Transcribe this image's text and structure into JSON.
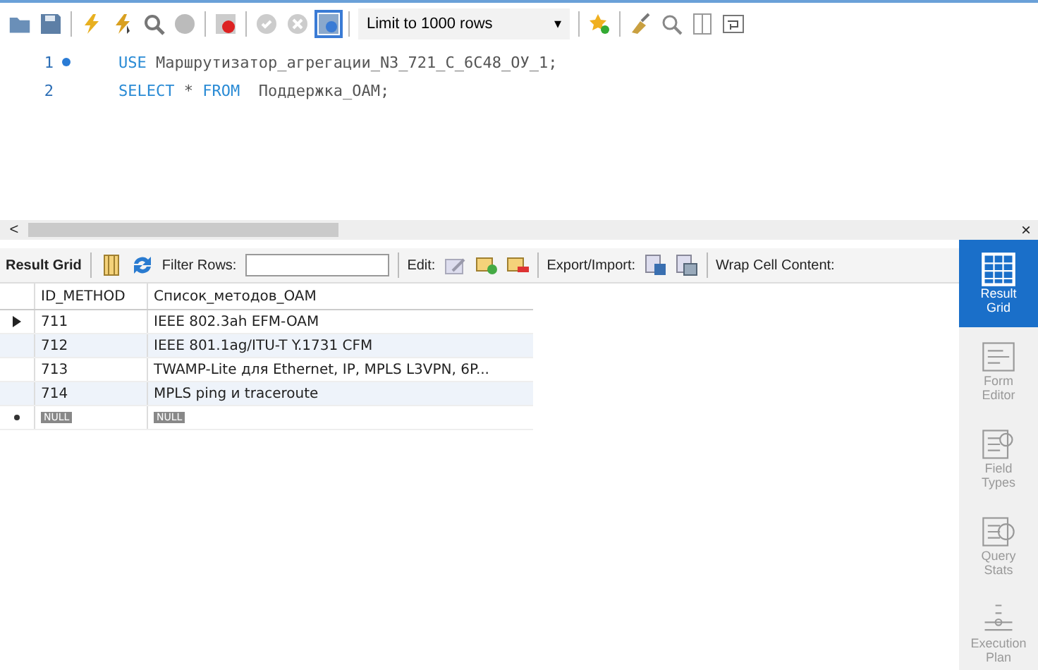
{
  "toolbar": {
    "limit": "Limit to 1000 rows",
    "caret": "▾"
  },
  "editor": {
    "lines": [
      {
        "number": "1",
        "marker": true,
        "keyword": "USE",
        "rest": "Маршрутизатор_агрегации_N3_721_C_6C48_ОУ_1;"
      },
      {
        "number": "2",
        "marker": false,
        "keyword": "SELECT",
        "rest": "* ",
        "keyword2": "FROM",
        "rest2": "Поддержка_OAM;"
      }
    ]
  },
  "scroll_left": "<",
  "close": "×",
  "result_toolbar": {
    "result_grid": "Result Grid",
    "filter_label": "Filter Rows:",
    "edit_label": "Edit:",
    "export_label": "Export/Import:",
    "wrap_label": "Wrap Cell Content:"
  },
  "table": {
    "columns": [
      "ID_METHOD",
      "Список_методов_OAM"
    ],
    "rows": [
      {
        "selected": true,
        "cells": [
          "711",
          "IEEE 802.3ah EFM-OAM"
        ]
      },
      {
        "selected": false,
        "cells": [
          "712",
          "IEEE 801.1ag/ITU-T Y.1731 CFM"
        ]
      },
      {
        "selected": false,
        "cells": [
          "713",
          "TWAMP-Lite для Ethernet, IP, MPLS L3VPN, 6P..."
        ]
      },
      {
        "selected": false,
        "cells": [
          "714",
          "MPLS ping и traceroute"
        ]
      }
    ],
    "new_row": [
      "NULL",
      "NULL"
    ]
  },
  "side_panel": [
    {
      "kind": "grid",
      "label": "Result\nGrid",
      "selected": true
    },
    {
      "kind": "form",
      "label": "Form\nEditor",
      "selected": false
    },
    {
      "kind": "fields",
      "label": "Field\nTypes",
      "selected": false
    },
    {
      "kind": "stats",
      "label": "Query\nStats",
      "selected": false
    },
    {
      "kind": "plan",
      "label": "Execution\nPlan",
      "selected": false
    }
  ]
}
